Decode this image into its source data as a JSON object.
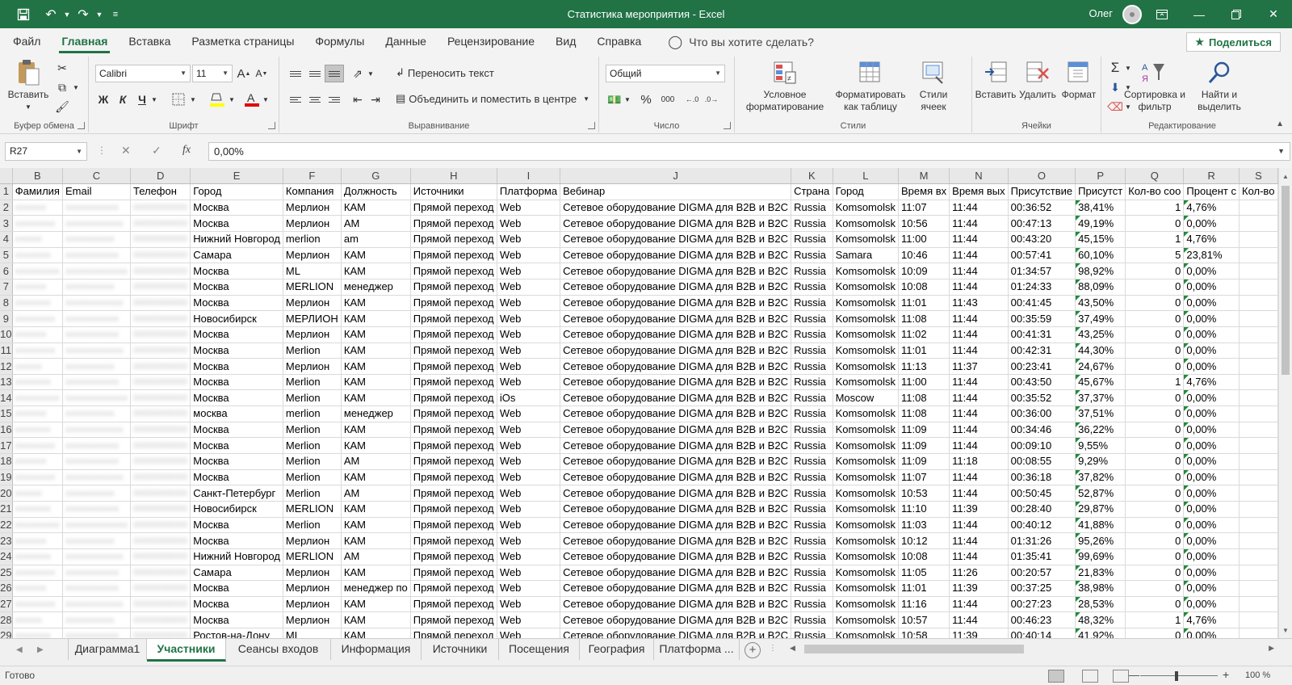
{
  "titlebar": {
    "doc_title": "Статистика мероприятия  -  Excel",
    "user": "Олег",
    "icons": [
      "save-icon",
      "undo-icon",
      "redo-icon",
      "customize-icon",
      "ribbon-display-icon",
      "minimize-icon",
      "restore-icon",
      "close-icon"
    ]
  },
  "ribbon_tabs": [
    "Файл",
    "Главная",
    "Вставка",
    "Разметка страницы",
    "Формулы",
    "Данные",
    "Рецензирование",
    "Вид",
    "Справка"
  ],
  "active_tab": "Главная",
  "tellme": "Что вы хотите сделать?",
  "share": "Поделиться",
  "ribbon": {
    "clipboard": {
      "label": "Буфер обмена",
      "paste": "Вставить"
    },
    "font": {
      "label": "Шрифт",
      "name": "Calibri",
      "size": "11",
      "bold": "Ж",
      "italic": "К",
      "underline": "Ч"
    },
    "alignment": {
      "label": "Выравнивание",
      "wrap": "Переносить текст",
      "merge": "Объединить и поместить в центре"
    },
    "number": {
      "label": "Число",
      "format": "Общий",
      "percent": "%",
      "thousands": "000"
    },
    "styles": {
      "label": "Стили",
      "cond": "Условное форматирование",
      "table": "Форматировать как таблицу",
      "cell": "Стили ячеек"
    },
    "cells": {
      "label": "Ячейки",
      "insert": "Вставить",
      "delete": "Удалить",
      "format": "Формат"
    },
    "editing": {
      "label": "Редактирование",
      "sort": "Сортировка и фильтр",
      "find": "Найти и выделить"
    }
  },
  "formula_bar": {
    "namebox": "R27",
    "formula": "0,00%",
    "fx": "fx"
  },
  "columns": [
    "B",
    "C",
    "D",
    "E",
    "F",
    "G",
    "H",
    "I",
    "J",
    "K",
    "L",
    "M",
    "N",
    "O",
    "P",
    "Q",
    "R",
    "S"
  ],
  "header_row": [
    "Фамилия",
    "Email",
    "Телефон",
    "Город",
    "Компания",
    "Должность",
    "Источники",
    "Платформа",
    "Вебинар",
    "Страна",
    "Город",
    "Время вх",
    "Время вых",
    "Присутствие",
    "Присутст",
    "Кол-во соо",
    "Процент с",
    "Кол-во"
  ],
  "webinar": "Сетевое оборудование DIGMA для B2B и B2C",
  "source": "Прямой переход",
  "rows": [
    {
      "n": "2",
      "city": "Москва",
      "company": "Мерлион",
      "position": "КАМ",
      "platform": "Web",
      "country": "Russia",
      "city2": "Komsomolsk",
      "tin": "11:07",
      "tout": "11:44",
      "presence": "00:36:52",
      "pct": "38,41%",
      "cnt": "1",
      "msgpct": "4,76%"
    },
    {
      "n": "3",
      "city": "Москва",
      "company": "Мерлион",
      "position": "АМ",
      "platform": "Web",
      "country": "Russia",
      "city2": "Komsomolsk",
      "tin": "10:56",
      "tout": "11:44",
      "presence": "00:47:13",
      "pct": "49,19%",
      "cnt": "0",
      "msgpct": "0,00%"
    },
    {
      "n": "4",
      "city": "Нижний Новгород",
      "company": "merlion",
      "position": "am",
      "platform": "Web",
      "country": "Russia",
      "city2": "Komsomolsk",
      "tin": "11:00",
      "tout": "11:44",
      "presence": "00:43:20",
      "pct": "45,15%",
      "cnt": "1",
      "msgpct": "4,76%"
    },
    {
      "n": "5",
      "city": "Самара",
      "company": "Мерлион",
      "position": "КАМ",
      "platform": "Web",
      "country": "Russia",
      "city2": "Samara",
      "tin": "10:46",
      "tout": "11:44",
      "presence": "00:57:41",
      "pct": "60,10%",
      "cnt": "5",
      "msgpct": "23,81%"
    },
    {
      "n": "6",
      "city": "Москва",
      "company": "ML",
      "position": "КАМ",
      "platform": "Web",
      "country": "Russia",
      "city2": "Komsomolsk",
      "tin": "10:09",
      "tout": "11:44",
      "presence": "01:34:57",
      "pct": "98,92%",
      "cnt": "0",
      "msgpct": "0,00%"
    },
    {
      "n": "7",
      "city": "Москва",
      "company": "MERLION",
      "position": "менеджер",
      "platform": "Web",
      "country": "Russia",
      "city2": "Komsomolsk",
      "tin": "10:08",
      "tout": "11:44",
      "presence": "01:24:33",
      "pct": "88,09%",
      "cnt": "0",
      "msgpct": "0,00%"
    },
    {
      "n": "8",
      "city": "Москва",
      "company": "Мерлион",
      "position": "КАМ",
      "platform": "Web",
      "country": "Russia",
      "city2": "Komsomolsk",
      "tin": "11:01",
      "tout": "11:43",
      "presence": "00:41:45",
      "pct": "43,50%",
      "cnt": "0",
      "msgpct": "0,00%"
    },
    {
      "n": "9",
      "city": "Новосибирск",
      "company": "МЕРЛИОН",
      "position": "КАМ",
      "platform": "Web",
      "country": "Russia",
      "city2": "Komsomolsk",
      "tin": "11:08",
      "tout": "11:44",
      "presence": "00:35:59",
      "pct": "37,49%",
      "cnt": "0",
      "msgpct": "0,00%"
    },
    {
      "n": "10",
      "city": "Москва",
      "company": "Мерлион",
      "position": "КАМ",
      "platform": "Web",
      "country": "Russia",
      "city2": "Komsomolsk",
      "tin": "11:02",
      "tout": "11:44",
      "presence": "00:41:31",
      "pct": "43,25%",
      "cnt": "0",
      "msgpct": "0,00%"
    },
    {
      "n": "11",
      "city": "Москва",
      "company": "Merlion",
      "position": "КАМ",
      "platform": "Web",
      "country": "Russia",
      "city2": "Komsomolsk",
      "tin": "11:01",
      "tout": "11:44",
      "presence": "00:42:31",
      "pct": "44,30%",
      "cnt": "0",
      "msgpct": "0,00%"
    },
    {
      "n": "12",
      "city": "Москва",
      "company": "Мерлион",
      "position": "КАМ",
      "platform": "Web",
      "country": "Russia",
      "city2": "Komsomolsk",
      "tin": "11:13",
      "tout": "11:37",
      "presence": "00:23:41",
      "pct": "24,67%",
      "cnt": "0",
      "msgpct": "0,00%"
    },
    {
      "n": "13",
      "city": "Москва",
      "company": "Merlion",
      "position": "КАМ",
      "platform": "Web",
      "country": "Russia",
      "city2": "Komsomolsk",
      "tin": "11:00",
      "tout": "11:44",
      "presence": "00:43:50",
      "pct": "45,67%",
      "cnt": "1",
      "msgpct": "4,76%"
    },
    {
      "n": "14",
      "city": "Москва",
      "company": "Merlion",
      "position": "КАМ",
      "platform": "iOs",
      "country": "Russia",
      "city2": "Moscow",
      "tin": "11:08",
      "tout": "11:44",
      "presence": "00:35:52",
      "pct": "37,37%",
      "cnt": "0",
      "msgpct": "0,00%"
    },
    {
      "n": "15",
      "city": "москва",
      "company": "merlion",
      "position": "менеджер",
      "platform": "Web",
      "country": "Russia",
      "city2": "Komsomolsk",
      "tin": "11:08",
      "tout": "11:44",
      "presence": "00:36:00",
      "pct": "37,51%",
      "cnt": "0",
      "msgpct": "0,00%"
    },
    {
      "n": "16",
      "city": "Москва",
      "company": "Merlion",
      "position": "КАМ",
      "platform": "Web",
      "country": "Russia",
      "city2": "Komsomolsk",
      "tin": "11:09",
      "tout": "11:44",
      "presence": "00:34:46",
      "pct": "36,22%",
      "cnt": "0",
      "msgpct": "0,00%"
    },
    {
      "n": "17",
      "city": "Москва",
      "company": "Merlion",
      "position": "КАМ",
      "platform": "Web",
      "country": "Russia",
      "city2": "Komsomolsk",
      "tin": "11:09",
      "tout": "11:44",
      "presence": "00:09:10",
      "pct": "9,55%",
      "cnt": "0",
      "msgpct": "0,00%"
    },
    {
      "n": "18",
      "city": "Москва",
      "company": "Merlion",
      "position": "АМ",
      "platform": "Web",
      "country": "Russia",
      "city2": "Komsomolsk",
      "tin": "11:09",
      "tout": "11:18",
      "presence": "00:08:55",
      "pct": "9,29%",
      "cnt": "0",
      "msgpct": "0,00%"
    },
    {
      "n": "19",
      "city": "Москва",
      "company": "Merlion",
      "position": "КАМ",
      "platform": "Web",
      "country": "Russia",
      "city2": "Komsomolsk",
      "tin": "11:07",
      "tout": "11:44",
      "presence": "00:36:18",
      "pct": "37,82%",
      "cnt": "0",
      "msgpct": "0,00%"
    },
    {
      "n": "20",
      "city": "Санкт-Петербург",
      "company": "Merlion",
      "position": "АМ",
      "platform": "Web",
      "country": "Russia",
      "city2": "Komsomolsk",
      "tin": "10:53",
      "tout": "11:44",
      "presence": "00:50:45",
      "pct": "52,87%",
      "cnt": "0",
      "msgpct": "0,00%"
    },
    {
      "n": "21",
      "city": "Новосибирск",
      "company": "MERLION",
      "position": "КАМ",
      "platform": "Web",
      "country": "Russia",
      "city2": "Komsomolsk",
      "tin": "11:10",
      "tout": "11:39",
      "presence": "00:28:40",
      "pct": "29,87%",
      "cnt": "0",
      "msgpct": "0,00%"
    },
    {
      "n": "22",
      "city": "Москва",
      "company": "Merlion",
      "position": "КАМ",
      "platform": "Web",
      "country": "Russia",
      "city2": "Komsomolsk",
      "tin": "11:03",
      "tout": "11:44",
      "presence": "00:40:12",
      "pct": "41,88%",
      "cnt": "0",
      "msgpct": "0,00%"
    },
    {
      "n": "23",
      "city": "Москва",
      "company": "Мерлион",
      "position": "КАМ",
      "platform": "Web",
      "country": "Russia",
      "city2": "Komsomolsk",
      "tin": "10:12",
      "tout": "11:44",
      "presence": "01:31:26",
      "pct": "95,26%",
      "cnt": "0",
      "msgpct": "0,00%"
    },
    {
      "n": "24",
      "city": "Нижний Новгород",
      "company": "MERLION",
      "position": "АМ",
      "platform": "Web",
      "country": "Russia",
      "city2": "Komsomolsk",
      "tin": "10:08",
      "tout": "11:44",
      "presence": "01:35:41",
      "pct": "99,69%",
      "cnt": "0",
      "msgpct": "0,00%"
    },
    {
      "n": "25",
      "city": "Самара",
      "company": "Мерлион",
      "position": "КАМ",
      "platform": "Web",
      "country": "Russia",
      "city2": "Komsomolsk",
      "tin": "11:05",
      "tout": "11:26",
      "presence": "00:20:57",
      "pct": "21,83%",
      "cnt": "0",
      "msgpct": "0,00%"
    },
    {
      "n": "26",
      "city": "Москва",
      "company": "Мерлион",
      "position": "менеджер по",
      "platform": "Web",
      "country": "Russia",
      "city2": "Komsomolsk",
      "tin": "11:01",
      "tout": "11:39",
      "presence": "00:37:25",
      "pct": "38,98%",
      "cnt": "0",
      "msgpct": "0,00%"
    },
    {
      "n": "27",
      "city": "Москва",
      "company": "Мерлион",
      "position": "КАМ",
      "platform": "Web",
      "country": "Russia",
      "city2": "Komsomolsk",
      "tin": "11:16",
      "tout": "11:44",
      "presence": "00:27:23",
      "pct": "28,53%",
      "cnt": "0",
      "msgpct": "0,00%"
    },
    {
      "n": "28",
      "city": "Москва",
      "company": "Мерлион",
      "position": "КАМ",
      "platform": "Web",
      "country": "Russia",
      "city2": "Komsomolsk",
      "tin": "10:57",
      "tout": "11:44",
      "presence": "00:46:23",
      "pct": "48,32%",
      "cnt": "1",
      "msgpct": "4,76%"
    },
    {
      "n": "29",
      "city": "Ростов-на-Дону",
      "company": "ML",
      "position": "КАМ",
      "platform": "Web",
      "country": "Russia",
      "city2": "Komsomolsk",
      "tin": "10:58",
      "tout": "11:39",
      "presence": "00:40:14",
      "pct": "41,92%",
      "cnt": "0",
      "msgpct": "0,00%"
    }
  ],
  "sheet_tabs": [
    "Диаграмма1",
    "Участники",
    "Сеансы входов",
    "Информация",
    "Источники",
    "Посещения",
    "География",
    "Платформа ..."
  ],
  "active_sheet": "Участники",
  "status": {
    "text": "Готово",
    "zoom": "100 %"
  },
  "colors": {
    "accent": "#217346",
    "comment_triangle": "#1e8c3a"
  }
}
